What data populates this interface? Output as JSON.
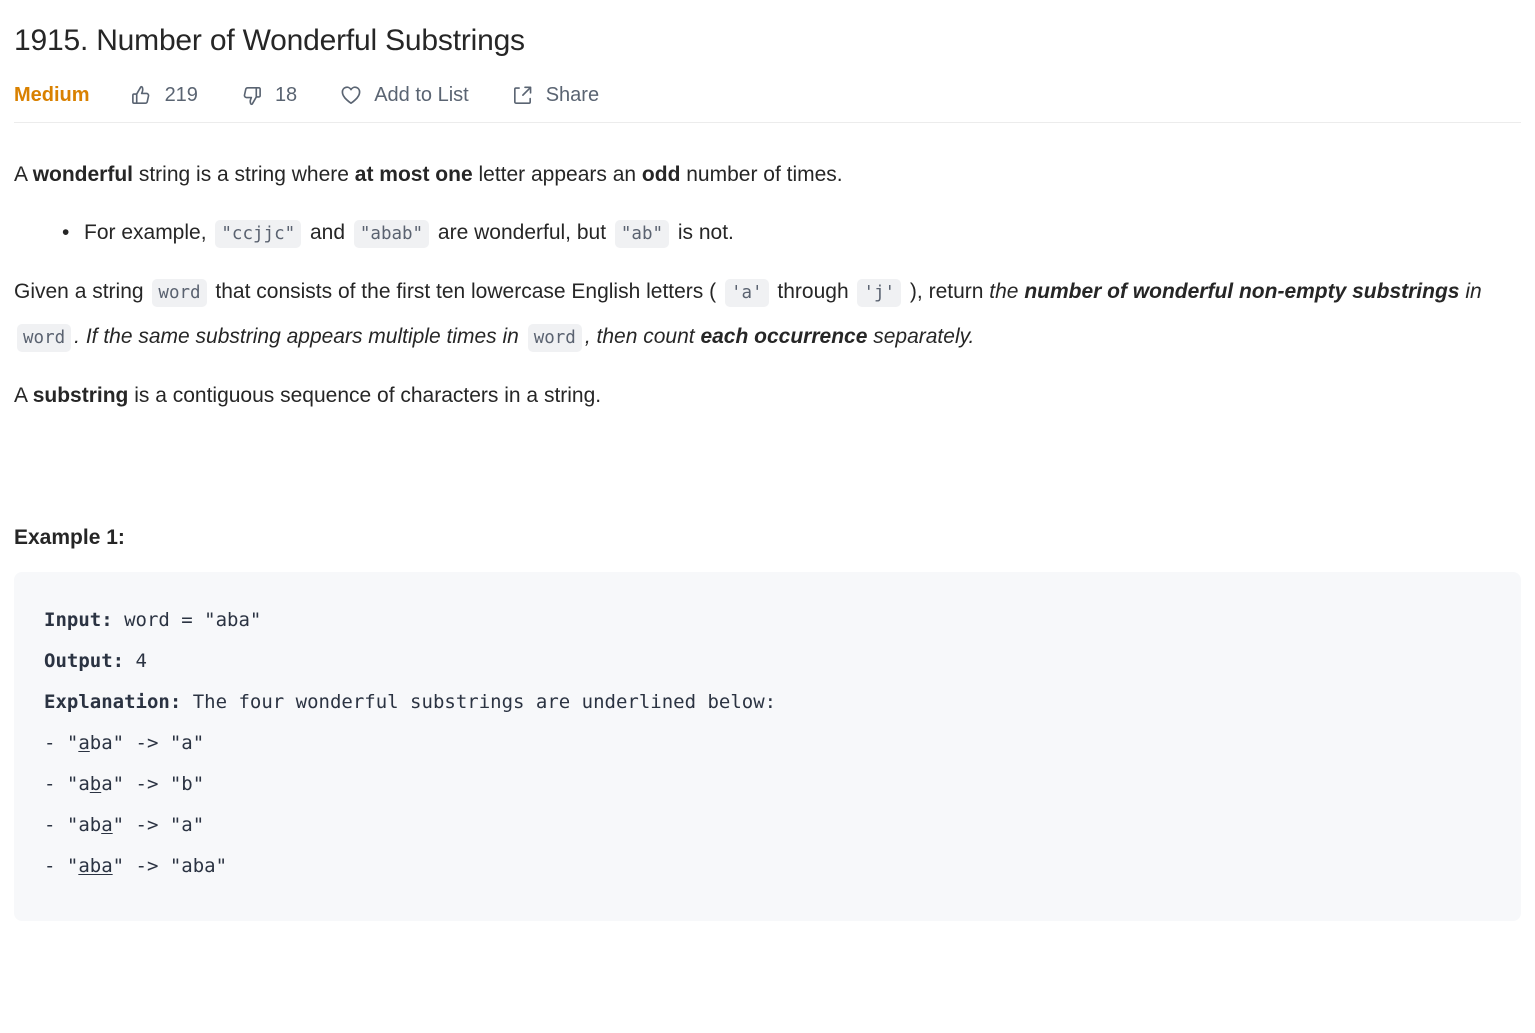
{
  "header": {
    "title": "1915. Number of Wonderful Substrings",
    "difficulty": "Medium",
    "difficulty_color": "#d98100",
    "actions": [
      {
        "icon": "thumbs-up-icon",
        "label": "219"
      },
      {
        "icon": "thumbs-down-icon",
        "label": "18"
      },
      {
        "icon": "heart-icon",
        "label": "Add to List"
      },
      {
        "icon": "share-icon",
        "label": "Share"
      }
    ]
  },
  "description": {
    "p1": {
      "t1": "A ",
      "b1": "wonderful",
      "t2": " string is a string where ",
      "b2": "at most one",
      "t3": " letter appears an ",
      "b3": "odd",
      "t4": " number of times."
    },
    "bullet1": {
      "t1": "For example, ",
      "c1": "\"ccjjc\"",
      "t2": " and ",
      "c2": "\"abab\"",
      "t3": " are wonderful, but ",
      "c3": "\"ab\"",
      "t4": " is not."
    },
    "p2": {
      "t1": "Given a string ",
      "c1": "word",
      "t2": " that consists of the first ten lowercase English letters ( ",
      "c2": "'a'",
      "t3": " through ",
      "c3": "'j'",
      "t4": " ), return ",
      "i1": "the ",
      "bi1": "number of wonderful non-empty substrings",
      "i2": " in ",
      "c4": "word",
      "i3": ". If the same substring appears multiple times in ",
      "c5": "word",
      "i4": ", then count ",
      "bi2": "each occurrence",
      "i5": " separately."
    },
    "p3": {
      "t1": "A ",
      "b1": "substring",
      "t2": " is a contiguous sequence of characters in a string."
    }
  },
  "example": {
    "heading": "Example 1:",
    "code": {
      "input_label": "Input:",
      "input_value": " word = \"aba\"",
      "output_label": "Output:",
      "output_value": " 4",
      "explanation_label": "Explanation:",
      "explanation_value": " The four wonderful substrings are underlined below:",
      "lines": [
        {
          "prefix": "- \"",
          "underlined": "a",
          "rest": "ba\" -> \"a\""
        },
        {
          "prefix": "- \"a",
          "underlined": "b",
          "rest": "a\" -> \"b\""
        },
        {
          "prefix": "- \"ab",
          "underlined": "a",
          "rest": "\" -> \"a\""
        },
        {
          "prefix": "- \"",
          "underlined": "aba",
          "rest": "\" -> \"aba\""
        }
      ]
    }
  }
}
